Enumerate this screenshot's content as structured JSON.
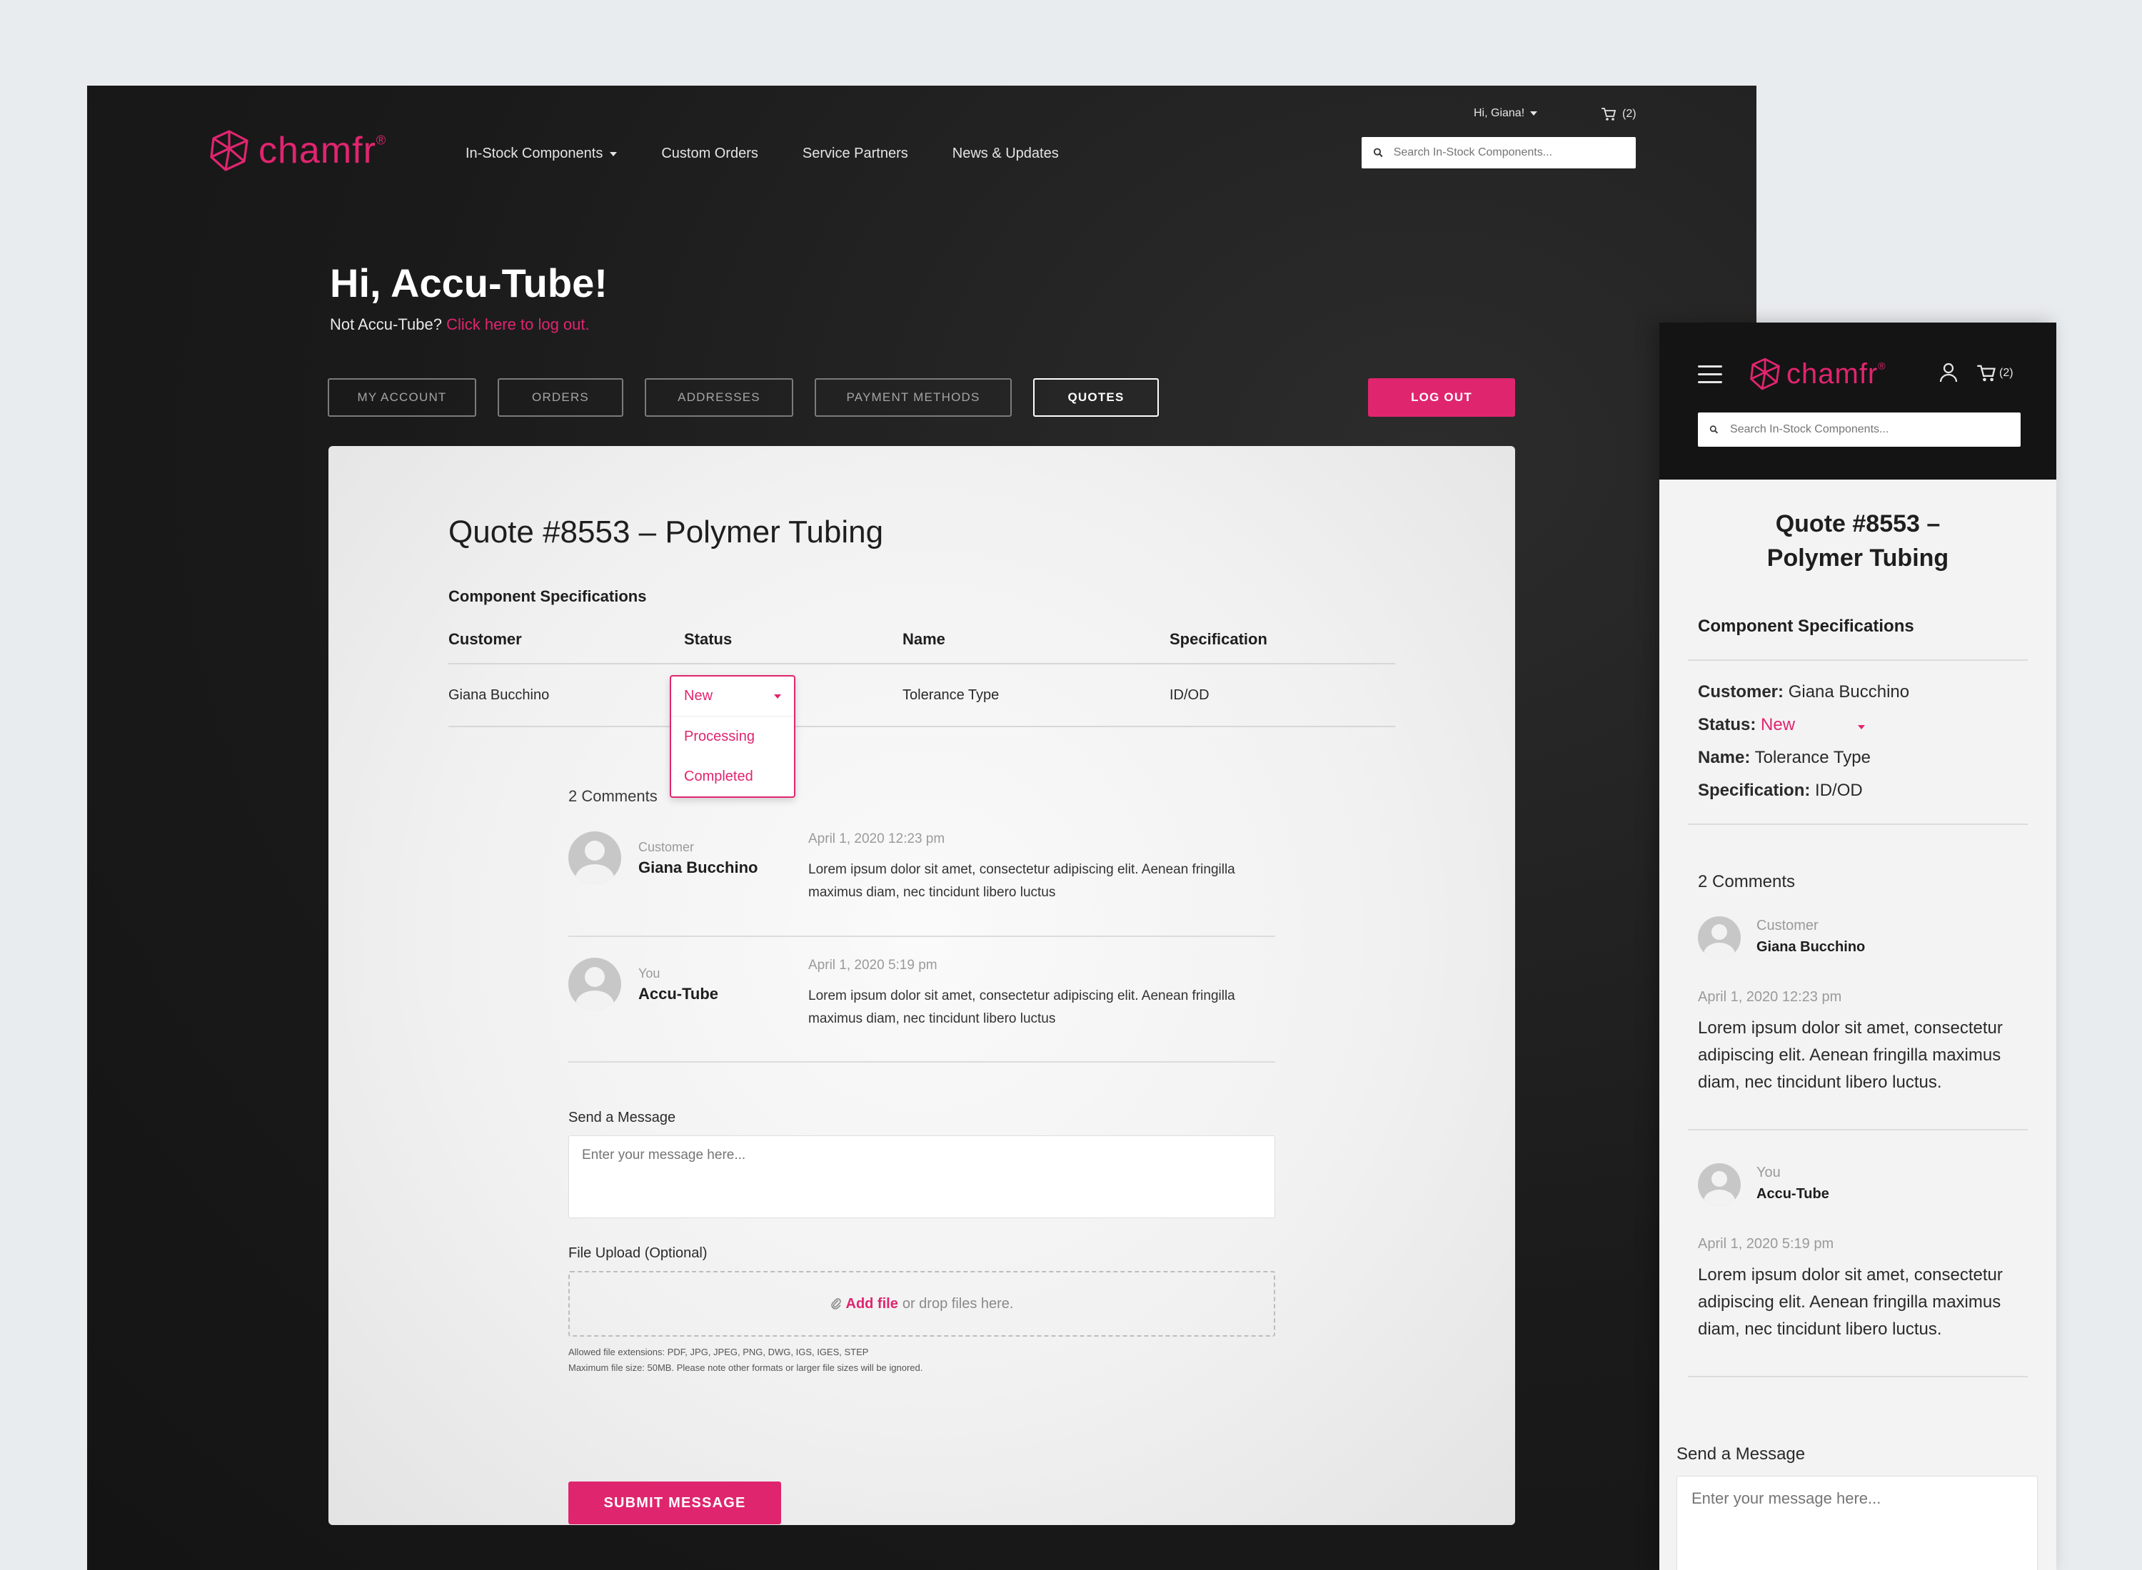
{
  "brand": {
    "name": "chamfr",
    "trademark": "®",
    "accent": "#e0256f"
  },
  "desktop": {
    "nav": [
      "In-Stock Components",
      "Custom Orders",
      "Service Partners",
      "News & Updates"
    ],
    "greeting": "Hi, Giana!",
    "cart_count": "(2)",
    "search_placeholder": "Search In-Stock Components...",
    "hello": "Hi, Accu-Tube!",
    "not_user": "Not Accu-Tube?",
    "logout_link": "Click here to log out.",
    "tabs": [
      "MY ACCOUNT",
      "ORDERS",
      "ADDRESSES",
      "PAYMENT METHODS",
      "QUOTES"
    ],
    "active_tab": "QUOTES",
    "logout_button": "LOG OUT",
    "quote_title": "Quote #8553 – Polymer Tubing",
    "spec_heading": "Component Specifications",
    "table": {
      "headers": [
        "Customer",
        "Status",
        "Name",
        "Specification"
      ],
      "row": {
        "customer": "Giana Bucchino",
        "status": "New",
        "name": "Tolerance Type",
        "specification": "ID/OD"
      }
    },
    "status_options": [
      "New",
      "Processing",
      "Completed"
    ],
    "comments_count": "2 Comments",
    "comments": [
      {
        "role": "Customer",
        "name": "Giana Bucchino",
        "date": "April 1, 2020 12:23 pm",
        "text": "Lorem ipsum dolor sit amet, consectetur adipiscing elit. Aenean fringilla maximus diam, nec tincidunt libero luctus"
      },
      {
        "role": "You",
        "name": "Accu-Tube",
        "date": "April 1, 2020 5:19 pm",
        "text": "Lorem ipsum dolor sit amet, consectetur adipiscing elit. Aenean fringilla maximus diam, nec tincidunt libero luctus"
      }
    ],
    "send_label": "Send a Message",
    "message_placeholder": "Enter your message here...",
    "upload_label": "File Upload (Optional)",
    "add_file": "Add file",
    "drop_text": "or drop files here.",
    "allowed_note": "Allowed file extensions: PDF, JPG, JPEG, PNG, DWG, IGS, IGES, STEP",
    "size_note": "Maximum file size: 50MB. Please note other formats or larger file sizes will be ignored.",
    "submit_button": "SUBMIT MESSAGE"
  },
  "mobile": {
    "cart_count": "(2)",
    "search_placeholder": "Search In-Stock Components...",
    "quote_title_line1": "Quote #8553 –",
    "quote_title_line2": "Polymer Tubing",
    "spec_heading": "Component Specifications",
    "fields": [
      {
        "label": "Customer:",
        "value": "Giana Bucchino"
      },
      {
        "label": "Status:",
        "value": "New"
      },
      {
        "label": "Name:",
        "value": "Tolerance Type"
      },
      {
        "label": "Specification:",
        "value": "ID/OD"
      }
    ],
    "comments_count": "2 Comments",
    "comments": [
      {
        "role": "Customer",
        "name": "Giana Bucchino",
        "date": "April 1, 2020 12:23 pm",
        "text": "Lorem ipsum dolor sit amet, consectetur adipiscing elit. Aenean fringilla maximus diam, nec tincidunt libero luctus."
      },
      {
        "role": "You",
        "name": "Accu-Tube",
        "date": "April 1, 2020 5:19 pm",
        "text": "Lorem ipsum dolor sit amet, consectetur adipiscing elit. Aenean fringilla maximus diam, nec tincidunt libero luctus."
      }
    ],
    "send_label": "Send a Message",
    "message_placeholder": "Enter your message here..."
  }
}
